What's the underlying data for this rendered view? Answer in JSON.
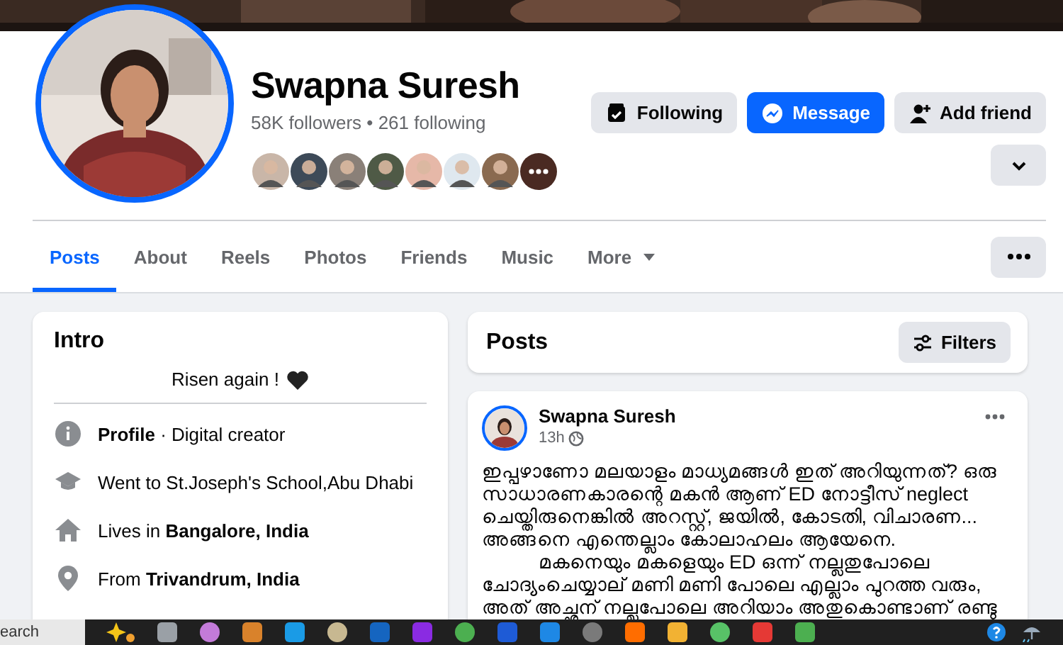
{
  "profile": {
    "name": "Swapna Suresh",
    "stats": "58K followers • 261 following"
  },
  "actions": [
    {
      "kind": "following",
      "label": "Following",
      "primary": false
    },
    {
      "kind": "message",
      "label": "Message",
      "primary": true
    },
    {
      "kind": "add_friend",
      "label": "Add friend",
      "primary": false
    }
  ],
  "tabs": [
    {
      "label": "Posts",
      "selected": true,
      "has_menu": false
    },
    {
      "label": "About",
      "selected": false,
      "has_menu": false
    },
    {
      "label": "Reels",
      "selected": false,
      "has_menu": false
    },
    {
      "label": "Photos",
      "selected": false,
      "has_menu": false
    },
    {
      "label": "Friends",
      "selected": false,
      "has_menu": false
    },
    {
      "label": "Music",
      "selected": false,
      "has_menu": false
    },
    {
      "label": "More",
      "selected": false,
      "has_menu": true
    }
  ],
  "intro": {
    "title": "Intro",
    "bio": "Risen again !",
    "items": [
      {
        "kind": "info",
        "text": "**Profile** · Digital creator"
      },
      {
        "kind": "school",
        "text": "Went to St.Joseph's School,Abu Dhabi"
      },
      {
        "kind": "home",
        "text": "Lives in **Bangalore, India**"
      },
      {
        "kind": "place",
        "text": "From **Trivandrum, India**"
      }
    ]
  },
  "posts": {
    "title": "Posts",
    "filters_label": "Filters"
  },
  "post": {
    "author": "Swapna Suresh",
    "time": "13h",
    "paragraphs": [
      "ഇപ്പഴാണോ മലയാളം മാധ്യമങ്ങൾ ഇത് അറിയുന്നത്? ഒരു\nസാധാരണകാരന്റെ മകൻ ആണ് ED നോട്ടീസ് neglect\nചെയ്തിരുനെങ്കിൽ അറസ്റ്റ്, ജയിൽ, കോടതി, വിചാരണ...\nഅങ്ങനെ എന്തെല്ലാം കോലാഹലം ആയേനെ.",
      "മകനെയും മകളെയും ED ഒന്ന് നല്ലതുപോലെ\nചോദ്യംചെയ്യാല് മണി മണി പോലെ എല്ലാം പുറത്ത വരും,\nഅത് അച്ഛന് നല്ലപോലെ അറിയാം അതുകൊണ്ടാണ് രണ്ടു"
    ]
  },
  "taskbar": {
    "search_text": "earch"
  }
}
